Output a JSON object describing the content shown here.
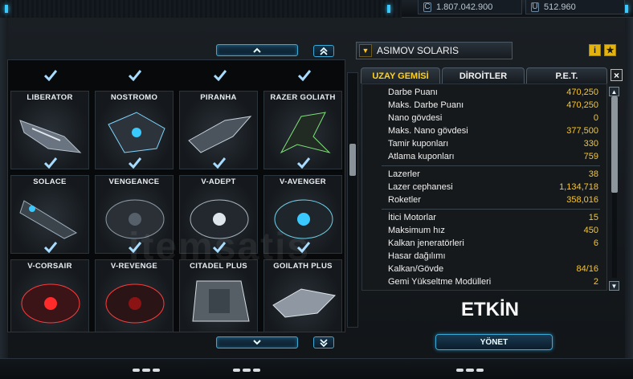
{
  "currency": {
    "credits": "1.807.042.900",
    "uridium": "512.960"
  },
  "ship_select": {
    "selected": "ASIMOV SOLARIS"
  },
  "tabs": [
    "UZAY GEMİSİ",
    "DİROİTLER",
    "P.E.T."
  ],
  "ships": [
    {
      "name": "LIBERATOR"
    },
    {
      "name": "NOSTROMO"
    },
    {
      "name": "PIRANHA"
    },
    {
      "name": "RAZER GOLIATH"
    },
    {
      "name": "SOLACE"
    },
    {
      "name": "VENGEANCE"
    },
    {
      "name": "V-ADEPT"
    },
    {
      "name": "V-AVENGER"
    },
    {
      "name": "V-CORSAIR"
    },
    {
      "name": "V-REVENGE"
    },
    {
      "name": "CITADEL PLUS"
    },
    {
      "name": "GOILATH PLUS"
    }
  ],
  "stats": {
    "group1": [
      {
        "label": "Darbe Puanı",
        "value": "470,250"
      },
      {
        "label": "Maks. Darbe Puanı",
        "value": "470,250"
      },
      {
        "label": "Nano gövdesi",
        "value": "0"
      },
      {
        "label": "Maks. Nano gövdesi",
        "value": "377,500"
      },
      {
        "label": "Tamir kuponları",
        "value": "330"
      },
      {
        "label": "Atlama kuponları",
        "value": "759"
      }
    ],
    "group2": [
      {
        "label": "Lazerler",
        "value": "38"
      },
      {
        "label": "Lazer cephanesi",
        "value": "1,134,718"
      },
      {
        "label": "Roketler",
        "value": "358,016"
      }
    ],
    "group3": [
      {
        "label": "İtici Motorlar",
        "value": "15"
      },
      {
        "label": "Maksimum hız",
        "value": "450"
      },
      {
        "label": "Kalkan jeneratörleri",
        "value": "6"
      },
      {
        "label": "Hasar dağılımı",
        "value": ""
      },
      {
        "label": "Kalkan/Gövde",
        "value": "84/16"
      },
      {
        "label": "Gemi Yükseltme Modülleri",
        "value": "2"
      }
    ]
  },
  "status": "ETKİN",
  "manage_button": "YÖNET",
  "colors": {
    "accent_gold": "#ffc61c",
    "accent_cyan": "#39c9ff",
    "check": "#9fd8ff"
  },
  "icons": {
    "info": "i",
    "star": "★"
  }
}
